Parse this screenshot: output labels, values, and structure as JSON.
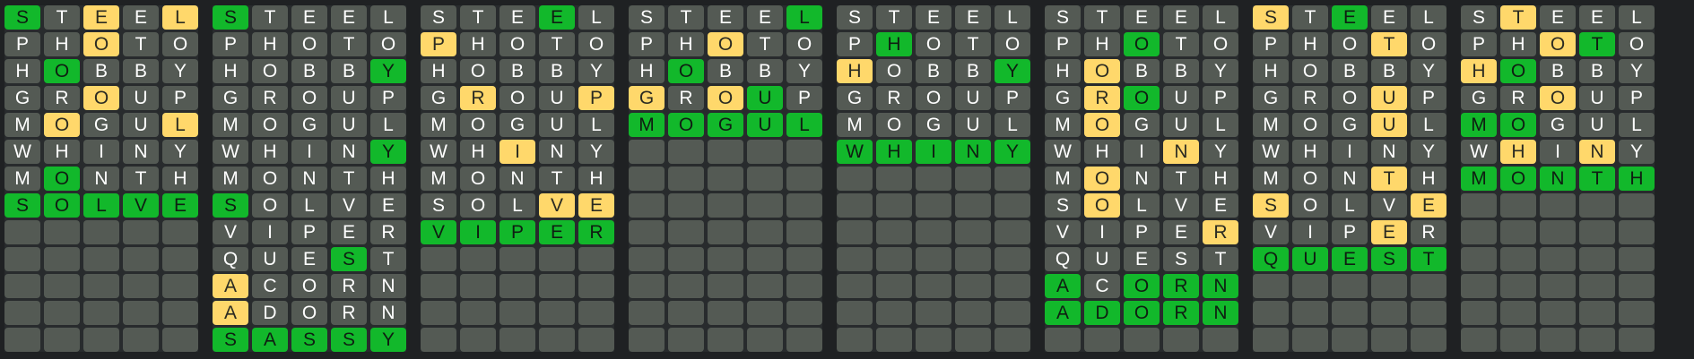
{
  "colors": {
    "green": "#12b82b",
    "yellow": "#ffd86b",
    "gray": "#545a54",
    "background": "#1f2123"
  },
  "rows_per_board": 13,
  "boards": [
    {
      "guesses": [
        {
          "word": "STEEL",
          "states": "GBYBY"
        },
        {
          "word": "PHOTO",
          "states": "BBYBB"
        },
        {
          "word": "HOBBY",
          "states": "BGBBB"
        },
        {
          "word": "GROUP",
          "states": "BBYBB"
        },
        {
          "word": "MOGUL",
          "states": "BYBBY"
        },
        {
          "word": "WHINY",
          "states": "BBBBB"
        },
        {
          "word": "MONTH",
          "states": "BGBBB"
        },
        {
          "word": "SOLVE",
          "states": "GGGGG"
        }
      ]
    },
    {
      "guesses": [
        {
          "word": "STEEL",
          "states": "GBBBB"
        },
        {
          "word": "PHOTO",
          "states": "BBBBB"
        },
        {
          "word": "HOBBY",
          "states": "BBBBG"
        },
        {
          "word": "GROUP",
          "states": "BBBBB"
        },
        {
          "word": "MOGUL",
          "states": "BBBBB"
        },
        {
          "word": "WHINY",
          "states": "BBBBG"
        },
        {
          "word": "MONTH",
          "states": "BBBBB"
        },
        {
          "word": "SOLVE",
          "states": "GBBBB"
        },
        {
          "word": "VIPER",
          "states": "BBBBB"
        },
        {
          "word": "QUEST",
          "states": "BBBGB"
        },
        {
          "word": "ACORN",
          "states": "YBBBB"
        },
        {
          "word": "ADORN",
          "states": "YBBBB"
        },
        {
          "word": "SASSY",
          "states": "GGGGG"
        }
      ]
    },
    {
      "guesses": [
        {
          "word": "STEEL",
          "states": "BBBGB"
        },
        {
          "word": "PHOTO",
          "states": "YBBBB"
        },
        {
          "word": "HOBBY",
          "states": "BBBBB"
        },
        {
          "word": "GROUP",
          "states": "BYBBY"
        },
        {
          "word": "MOGUL",
          "states": "BBBBB"
        },
        {
          "word": "WHINY",
          "states": "BBYBB"
        },
        {
          "word": "MONTH",
          "states": "BBBBB"
        },
        {
          "word": "SOLVE",
          "states": "BBBYY"
        },
        {
          "word": "VIPER",
          "states": "GGGGG"
        }
      ]
    },
    {
      "guesses": [
        {
          "word": "STEEL",
          "states": "BBBBG"
        },
        {
          "word": "PHOTO",
          "states": "BBYBB"
        },
        {
          "word": "HOBBY",
          "states": "BGBBB"
        },
        {
          "word": "GROUP",
          "states": "YBYGB"
        },
        {
          "word": "MOGUL",
          "states": "GGGGG"
        }
      ]
    },
    {
      "guesses": [
        {
          "word": "STEEL",
          "states": "BBBBB"
        },
        {
          "word": "PHOTO",
          "states": "BGBBB"
        },
        {
          "word": "HOBBY",
          "states": "YBBBG"
        },
        {
          "word": "GROUP",
          "states": "BBBBB"
        },
        {
          "word": "MOGUL",
          "states": "BBBBB"
        },
        {
          "word": "WHINY",
          "states": "GGGGG"
        }
      ]
    },
    {
      "guesses": [
        {
          "word": "STEEL",
          "states": "BBBBB"
        },
        {
          "word": "PHOTO",
          "states": "BBGBB"
        },
        {
          "word": "HOBBY",
          "states": "BYBBB"
        },
        {
          "word": "GROUP",
          "states": "BYGBB"
        },
        {
          "word": "MOGUL",
          "states": "BYBBB"
        },
        {
          "word": "WHINY",
          "states": "BBBYB"
        },
        {
          "word": "MONTH",
          "states": "BYBBB"
        },
        {
          "word": "SOLVE",
          "states": "BYBBB"
        },
        {
          "word": "VIPER",
          "states": "BBBBY"
        },
        {
          "word": "QUEST",
          "states": "BBBBB"
        },
        {
          "word": "ACORN",
          "states": "GBGGG"
        },
        {
          "word": "ADORN",
          "states": "GGGGG"
        }
      ]
    },
    {
      "guesses": [
        {
          "word": "STEEL",
          "states": "YBGBB"
        },
        {
          "word": "PHOTO",
          "states": "BBBYB"
        },
        {
          "word": "HOBBY",
          "states": "BBBBB"
        },
        {
          "word": "GROUP",
          "states": "BBBYB"
        },
        {
          "word": "MOGUL",
          "states": "BBBYB"
        },
        {
          "word": "WHINY",
          "states": "BBBBB"
        },
        {
          "word": "MONTH",
          "states": "BBBYB"
        },
        {
          "word": "SOLVE",
          "states": "YBBBY"
        },
        {
          "word": "VIPER",
          "states": "BBBYB"
        },
        {
          "word": "QUEST",
          "states": "GGGGG"
        }
      ]
    },
    {
      "guesses": [
        {
          "word": "STEEL",
          "states": "BYBBB"
        },
        {
          "word": "PHOTO",
          "states": "BBYGB"
        },
        {
          "word": "HOBBY",
          "states": "YGBBB"
        },
        {
          "word": "GROUP",
          "states": "BBYBB"
        },
        {
          "word": "MOGUL",
          "states": "GGBBB"
        },
        {
          "word": "WHINY",
          "states": "BYBYB"
        },
        {
          "word": "MONTH",
          "states": "GGGGG"
        }
      ]
    }
  ]
}
